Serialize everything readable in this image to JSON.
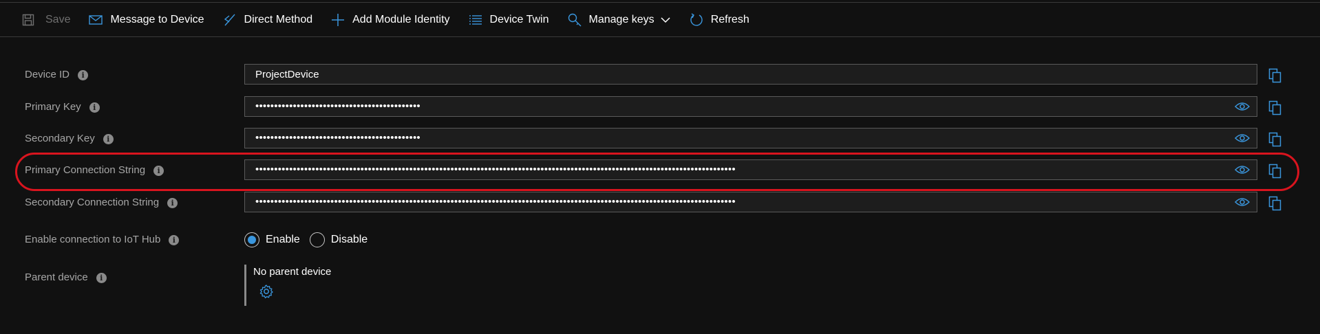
{
  "toolbar": {
    "save": "Save",
    "message": "Message to Device",
    "direct_method": "Direct Method",
    "add_module": "Add Module Identity",
    "device_twin": "Device Twin",
    "manage_keys": "Manage keys",
    "refresh": "Refresh"
  },
  "fields": {
    "device_id": {
      "label": "Device ID",
      "value": "ProjectDevice"
    },
    "primary_key": {
      "label": "Primary Key",
      "value": "••••••••••••••••••••••••••••••••••••••••••••"
    },
    "secondary_key": {
      "label": "Secondary Key",
      "value": "••••••••••••••••••••••••••••••••••••••••••••"
    },
    "primary_conn": {
      "label": "Primary Connection String",
      "value": "••••••••••••••••••••••••••••••••••••••••••••••••••••••••••••••••••••••••••••••••••••••••••••••••••••••••••••••••••••••••••••••••"
    },
    "secondary_conn": {
      "label": "Secondary Connection String",
      "value": "••••••••••••••••••••••••••••••••••••••••••••••••••••••••••••••••••••••••••••••••••••••••••••••••••••••••••••••••••••••••••••••••"
    }
  },
  "connection": {
    "label": "Enable connection to IoT Hub",
    "enable": "Enable",
    "disable": "Disable",
    "selected": "Enable"
  },
  "parent": {
    "label": "Parent device",
    "value": "No parent device"
  },
  "colors": {
    "accent": "#3a96dd",
    "highlight": "#d9141e",
    "background": "#111111"
  },
  "icons": {
    "save": "save-icon",
    "message": "mail-icon",
    "direct_method": "direct-method-icon",
    "add": "plus-icon",
    "twin": "list-icon",
    "keys": "key-icon",
    "refresh": "refresh-icon",
    "eye": "eye-icon",
    "copy": "copy-icon",
    "gear": "gear-icon",
    "info": "info-icon"
  }
}
